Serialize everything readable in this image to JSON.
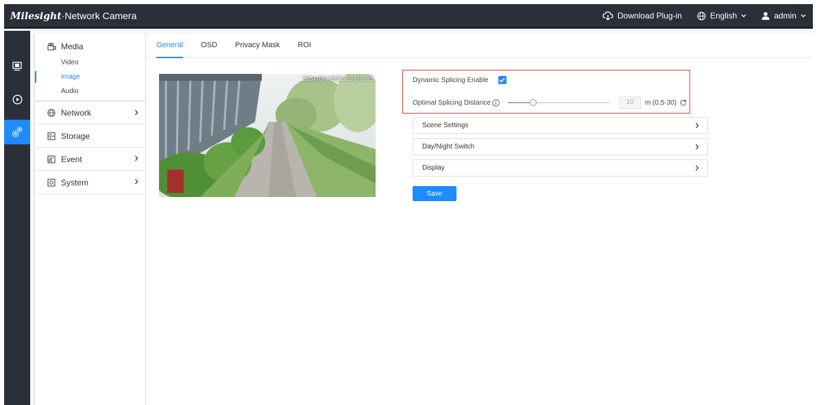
{
  "app": {
    "brand_logo": "Milesight",
    "brand_product": "·Network Camera"
  },
  "topbar": {
    "download_label": "Download Plug-in",
    "language_label": "English",
    "user_label": "admin"
  },
  "sidebar": {
    "media": {
      "label": "Media",
      "subitems": [
        "Video",
        "Image",
        "Audio"
      ],
      "active_sub": "Image"
    },
    "network_label": "Network",
    "storage_label": "Storage",
    "event_label": "Event",
    "system_label": "System"
  },
  "tabs": [
    "General",
    "OSD",
    "Privacy Mask",
    "ROI"
  ],
  "active_tab": "General",
  "preview": {
    "timestamp": "2024/04/2022 10:38:15"
  },
  "splicing": {
    "enable_label": "Dynamic Splicing Enable",
    "enabled": true,
    "distance_label": "Optimal Splicing Distance",
    "distance_value": "10",
    "distance_fraction": 0.25,
    "distance_range": "m (0.5-30)"
  },
  "sections": [
    "Scene Settings",
    "Day/Night Switch",
    "Display"
  ],
  "save_label": "Save",
  "colors": {
    "accent": "#1e8cff",
    "topbar": "#2b2f38",
    "highlight": "#e53935"
  }
}
